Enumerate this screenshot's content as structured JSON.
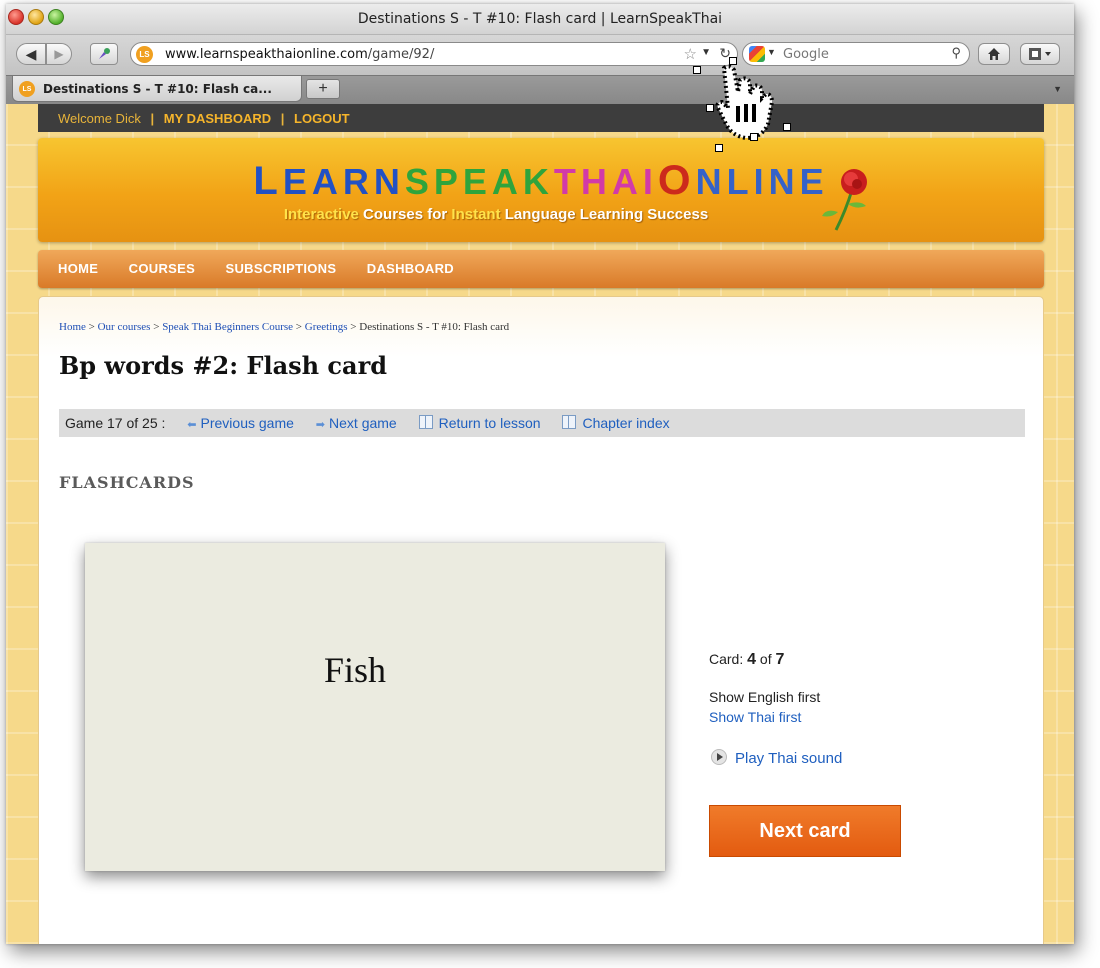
{
  "window": {
    "title": "Destinations S - T #10: Flash card | LearnSpeakThai"
  },
  "toolbar": {
    "site_icon": "LS",
    "url_domain": "www.learnspeakthaionline.com",
    "url_path": "/game/92/",
    "search_placeholder": "Google",
    "back_icon": "◀",
    "forward_icon": "▶",
    "home_icon": "home-icon"
  },
  "tabs": [
    {
      "label": "Destinations S - T #10: Flash ca..."
    }
  ],
  "newtab_label": "+",
  "userbar": {
    "welcome": "Welcome Dick",
    "dashboard": "MY DASHBOARD",
    "logout": "LOGOUT",
    "separator": "|"
  },
  "banner": {
    "logo": {
      "w1": "L",
      "w1b": "EARN",
      "w2": "SPEAK",
      "w3": "THAI",
      "o": "O",
      "w4": "NLINE"
    },
    "tagline": {
      "a": "Interactive",
      "b": " Courses for ",
      "c": "Instant",
      "d": " Language Learning Success"
    }
  },
  "mainnav": [
    "HOME",
    "COURSES",
    "SUBSCRIPTIONS",
    "DASHBOARD"
  ],
  "breadcrumb": {
    "items": [
      "Home",
      "Our courses",
      "Speak Thai Beginners Course",
      "Greetings"
    ],
    "current": "Destinations S - T #10: Flash card",
    "sep": ">"
  },
  "page": {
    "title": "Bp words #2: Flash card",
    "section": "FLASHCARDS"
  },
  "gamebar": {
    "counter": "Game 17 of 25 :",
    "prev": "Previous game",
    "next": "Next game",
    "return": "Return to lesson",
    "index": "Chapter index"
  },
  "flashcard": {
    "word": "Fish",
    "card_label": "Card:",
    "current": "4",
    "of": "of",
    "total": "7",
    "show_english": "Show English first",
    "show_thai": "Show Thai first",
    "play_sound": "Play Thai sound",
    "next_button": "Next card"
  },
  "colors": {
    "accent": "#e35b10",
    "link": "#1f5fbf",
    "banner": "#f2a316",
    "background": "#f6d98a"
  }
}
